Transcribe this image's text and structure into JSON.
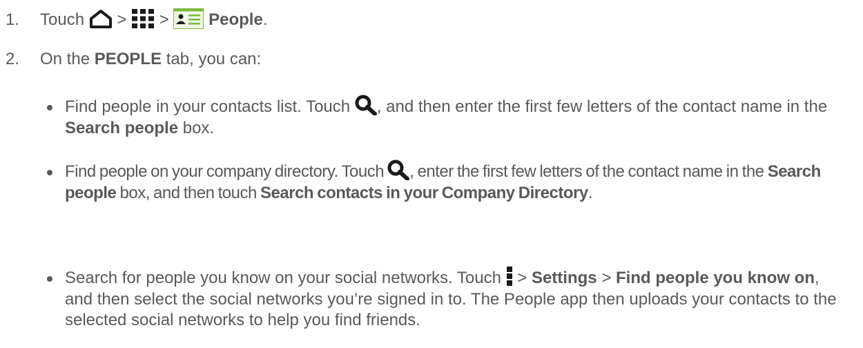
{
  "steps": [
    {
      "number": "1.",
      "prefix": "Touch",
      "sep1": ">",
      "sep2": ">",
      "bold": "People",
      "suffix": ".",
      "icons": [
        "home-icon",
        "apps-grid-icon",
        "people-app-icon"
      ]
    },
    {
      "number": "2.",
      "prefix": "On the",
      "bold": "PEOPLE",
      "suffix": "tab, you can:"
    }
  ],
  "bullets": [
    {
      "t1": "Find people in your contacts list. Touch",
      "t2": ", and then enter the first few letters of the contact name in the",
      "b1": "Search people",
      "t3": "box.",
      "icon": "search-icon"
    },
    {
      "t1": "Find people on your company directory. Touch",
      "t2": ", enter the first few letters of the contact name in the",
      "b1": "Search people",
      "t3": "box, and then touch",
      "b2": "Search contacts in your Company Directory",
      "t4": ".",
      "icon": "search-icon"
    },
    {
      "t1": "Search for people you know on your social networks. Touch",
      "sep1": ">",
      "b1": "Settings",
      "sep2": ">",
      "b2": "Find people you know on",
      "t2": ", and then select the social networks you’re signed in to. The People app then uploads your contacts to the selected social networks to help you find friends.",
      "icon": "menu-icon"
    }
  ],
  "colors": {
    "text": "#58595b",
    "icon": "#1a1a1a",
    "people_icon_bg": "#7dbb3c"
  }
}
